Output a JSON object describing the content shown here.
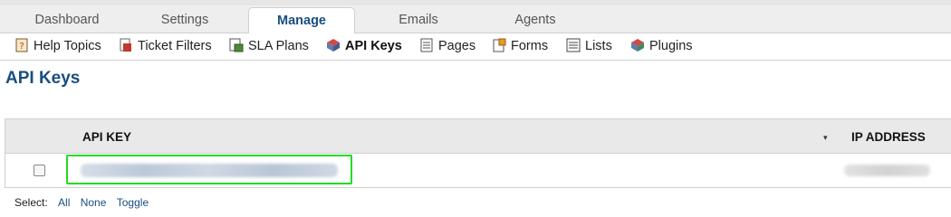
{
  "tabs": [
    {
      "label": "Dashboard",
      "active": false
    },
    {
      "label": "Settings",
      "active": false
    },
    {
      "label": "Manage",
      "active": true
    },
    {
      "label": "Emails",
      "active": false
    },
    {
      "label": "Agents",
      "active": false
    }
  ],
  "subnav": [
    {
      "label": "Help Topics",
      "icon": "help-topics-icon",
      "active": false
    },
    {
      "label": "Ticket Filters",
      "icon": "filter-icon",
      "active": false
    },
    {
      "label": "SLA Plans",
      "icon": "sla-plans-icon",
      "active": false
    },
    {
      "label": "API Keys",
      "icon": "api-keys-icon",
      "active": true
    },
    {
      "label": "Pages",
      "icon": "pages-icon",
      "active": false
    },
    {
      "label": "Forms",
      "icon": "forms-icon",
      "active": false
    },
    {
      "label": "Lists",
      "icon": "lists-icon",
      "active": false
    },
    {
      "label": "Plugins",
      "icon": "plugins-icon",
      "active": false
    }
  ],
  "page_title": "API Keys",
  "table": {
    "columns": [
      "API KEY",
      "IP ADDRESS"
    ],
    "sort_indicator": "▾",
    "rows": [
      {
        "checked": false,
        "api_key": "",
        "ip_address": ""
      }
    ]
  },
  "select": {
    "label": "Select:",
    "all": "All",
    "none": "None",
    "toggle": "Toggle"
  },
  "colors": {
    "accent": "#184e81",
    "highlight_border": "#22dd22",
    "tab_bar_bg": "#eeeeee",
    "table_header_bg": "#e9e9e9"
  }
}
